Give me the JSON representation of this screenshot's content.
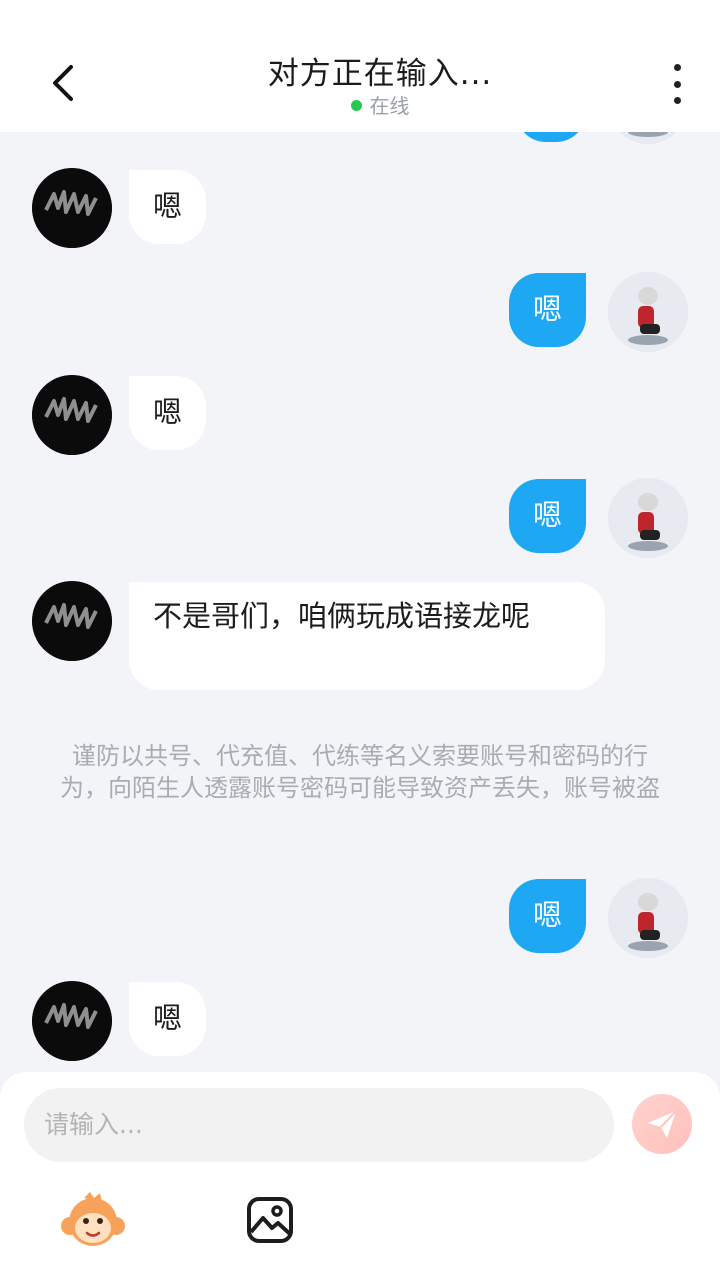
{
  "header": {
    "title": "对方正在输入...",
    "status": "在线",
    "status_color": "#2bc553"
  },
  "messages": [
    {
      "side": "other",
      "text": "嗯"
    },
    {
      "side": "self",
      "text": "嗯"
    },
    {
      "side": "other",
      "text": "嗯"
    },
    {
      "side": "self",
      "text": "嗯"
    },
    {
      "side": "other",
      "text": "不是哥们，咱俩玩成语接龙呢"
    },
    {
      "side": "self",
      "text": "嗯"
    },
    {
      "side": "other",
      "text": "嗯"
    }
  ],
  "notice": "谨防以共号、代充值、代练等名义索要账号和密码的行为，向陌生人透露账号密码可能导致资产丢失，账号被盗",
  "input": {
    "placeholder": "请输入..."
  },
  "toolbar": {
    "emoji_icon": "monkey-emoji-icon",
    "image_icon": "image-icon",
    "send_icon": "send-icon"
  },
  "colors": {
    "self_bubble": "#1ea7f2",
    "other_bubble": "#ffffff",
    "background": "#f2f4f7"
  }
}
